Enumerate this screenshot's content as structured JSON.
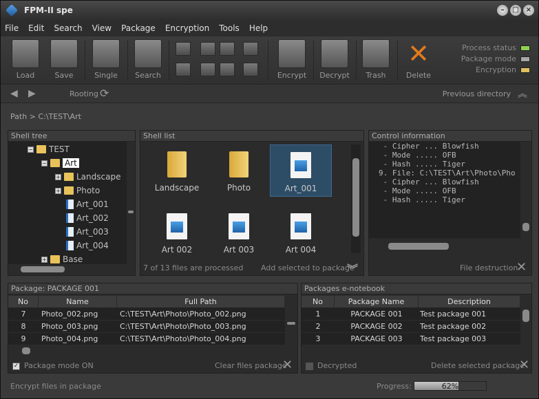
{
  "window": {
    "title": "FPM-II spe",
    "buttons": [
      "–",
      "□",
      "×"
    ]
  },
  "menu": [
    "File",
    "Edit",
    "Search",
    "View",
    "Package",
    "Encryption",
    "Tools",
    "Help"
  ],
  "toolbar": {
    "load": "Load",
    "save": "Save",
    "single": "Single",
    "search": "Search",
    "encrypt": "Encrypt",
    "decrypt": "Decrypt",
    "trash": "Trash",
    "delete": "Delete"
  },
  "status": {
    "process": "Process status",
    "package_mode": "Package mode",
    "encryption": "Encryption",
    "colors": {
      "process": "#8fd14f",
      "package_mode": "#a8a8a8",
      "encryption": "#e0c060"
    }
  },
  "nav": {
    "rooting": "Rooting",
    "previous_directory": "Previous directory"
  },
  "path": {
    "label": "Path >",
    "value": "C:\\TEST\\Art"
  },
  "shell_tree": {
    "title": "Shell tree",
    "items": [
      {
        "label": "TEST",
        "type": "folder"
      },
      {
        "label": "Art",
        "type": "folder"
      },
      {
        "label": "Landscape",
        "type": "folder"
      },
      {
        "label": "Photo",
        "type": "folder"
      },
      {
        "label": "Art_001",
        "type": "file"
      },
      {
        "label": "Art_002",
        "type": "file"
      },
      {
        "label": "Art_003",
        "type": "file"
      },
      {
        "label": "Art_004",
        "type": "file"
      },
      {
        "label": "Base",
        "type": "folder"
      }
    ]
  },
  "shell_list": {
    "title": "Shell list",
    "items": [
      "Landscape",
      "Photo",
      "Art_001",
      "Art 002",
      "Art 003",
      "Art 004"
    ],
    "processed": "7 of 13 files are processed",
    "add_selected": "Add selected to package"
  },
  "control": {
    "title": "Control information",
    "lines": [
      " - Cipher ... Blowfish",
      " - Mode ..... OFB",
      " - Hash ..... Tiger",
      "",
      "9. File: C:\\TEST\\Art\\Photo\\Pho",
      "",
      " - Cipher ... Blowfish",
      " - Mode ..... OFB",
      " - Hash ..... Tiger"
    ],
    "file_destruction": "File destruction"
  },
  "package": {
    "title": "Package: PACKAGE 001",
    "columns": [
      "No",
      "Name",
      "Full Path"
    ],
    "rows": [
      {
        "no": "7",
        "name": "Photo_002.png",
        "path": "C:\\TEST\\Art\\Photo\\Photo_002.png"
      },
      {
        "no": "8",
        "name": "Photo_003.png",
        "path": "C:\\TEST\\Art\\Photo\\Photo_003.png"
      },
      {
        "no": "9",
        "name": "Photo_004.png",
        "path": "C:\\TEST\\Art\\Photo\\Photo_004.png"
      }
    ],
    "mode_on": "Package mode ON",
    "clear": "Clear files package"
  },
  "notebook": {
    "title": "Packages e-notebook",
    "columns": [
      "No",
      "Package Name",
      "Description"
    ],
    "rows": [
      {
        "no": "1",
        "name": "PACKAGE 001",
        "desc": "Test package 001"
      },
      {
        "no": "2",
        "name": "PACKAGE 002",
        "desc": "Test package 002"
      },
      {
        "no": "3",
        "name": "PACKAGE 003",
        "desc": "Test package 003"
      }
    ],
    "decrypted": "Decrypted",
    "delete_selected": "Delete selected  package"
  },
  "statusbar": {
    "message": "Encrypt files in package",
    "progress_label": "Progress:",
    "progress_value": 62,
    "progress_text": "62%"
  }
}
